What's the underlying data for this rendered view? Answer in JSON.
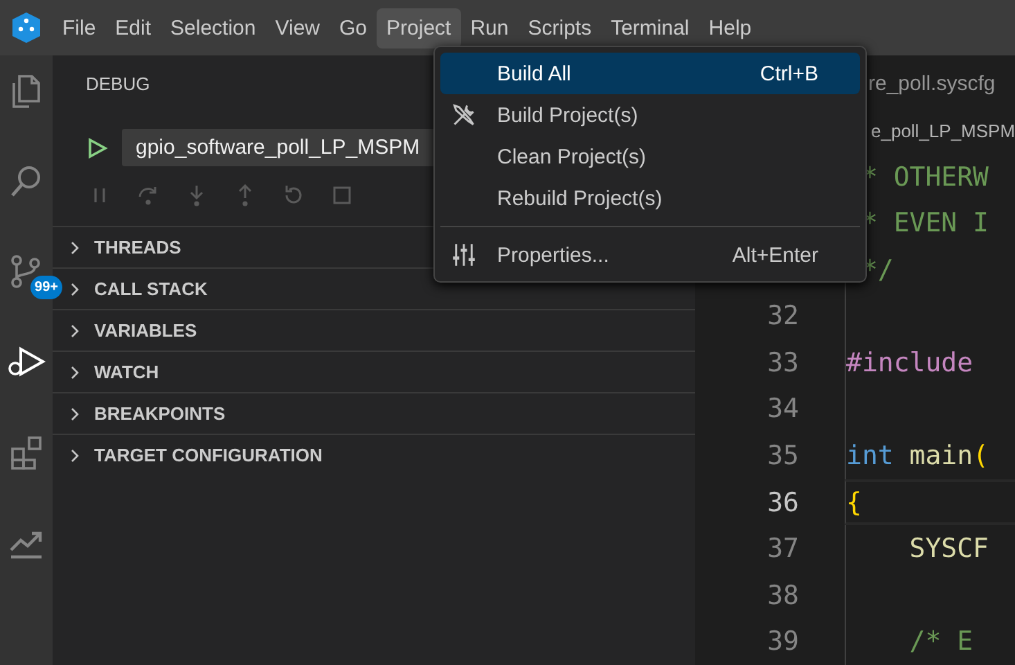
{
  "menubar": {
    "items": [
      {
        "label": "File",
        "selected": false
      },
      {
        "label": "Edit",
        "selected": false
      },
      {
        "label": "Selection",
        "selected": false
      },
      {
        "label": "View",
        "selected": false
      },
      {
        "label": "Go",
        "selected": false
      },
      {
        "label": "Project",
        "selected": true
      },
      {
        "label": "Run",
        "selected": false
      },
      {
        "label": "Scripts",
        "selected": false
      },
      {
        "label": "Terminal",
        "selected": false
      },
      {
        "label": "Help",
        "selected": false
      }
    ]
  },
  "activity_bar": {
    "items": [
      {
        "kind": "files",
        "selected": false
      },
      {
        "kind": "search",
        "selected": false
      },
      {
        "kind": "source-control",
        "selected": false,
        "badge": "99+"
      },
      {
        "kind": "debug",
        "selected": true
      },
      {
        "kind": "extensions",
        "selected": false
      },
      {
        "kind": "chart",
        "selected": false
      }
    ]
  },
  "sidebar": {
    "title": "DEBUG",
    "launch_config": "gpio_software_poll_LP_MSPM",
    "toolbar": [
      {
        "kind": "pause",
        "disabled": true
      },
      {
        "kind": "step-over",
        "disabled": true
      },
      {
        "kind": "step-into",
        "disabled": true
      },
      {
        "kind": "step-out",
        "disabled": true
      },
      {
        "kind": "restart",
        "disabled": true
      },
      {
        "kind": "stop",
        "disabled": true
      }
    ],
    "sections": [
      {
        "label": "THREADS",
        "expanded": false
      },
      {
        "label": "CALL STACK",
        "expanded": false
      },
      {
        "label": "VARIABLES",
        "expanded": false
      },
      {
        "label": "WATCH",
        "expanded": false
      },
      {
        "label": "BREAKPOINTS",
        "expanded": false
      },
      {
        "label": "TARGET CONFIGURATION",
        "expanded": false
      }
    ]
  },
  "editor": {
    "tab": "re_poll.syscfg",
    "breadcrumb": "e_poll_LP_MSPM",
    "lines": [
      {
        "segments": [
          {
            "text": " * OTHERW",
            "kind": "comment"
          }
        ]
      },
      {
        "segments": [
          {
            "text": " * EVEN I",
            "kind": "comment"
          }
        ]
      },
      {
        "segments": [
          {
            "text": " */",
            "kind": "comment"
          }
        ]
      },
      {
        "number": "32",
        "current": false
      },
      {
        "number": "33",
        "current": false,
        "segments": [
          {
            "text": "#include",
            "kind": "directive"
          }
        ]
      },
      {
        "number": "34",
        "current": false
      },
      {
        "number": "35",
        "current": false,
        "segments": [
          {
            "text": "int",
            "kind": "keyword"
          },
          {
            "text": " main",
            "kind": "function"
          },
          {
            "text": "(",
            "kind": "bracket"
          }
        ]
      },
      {
        "number": "36",
        "current": true,
        "segments": [
          {
            "text": "{",
            "kind": "bracket"
          }
        ]
      },
      {
        "number": "37",
        "current": false,
        "segments": [
          {
            "text": "    SYSCF",
            "kind": "function"
          }
        ]
      },
      {
        "number": "38",
        "current": false
      },
      {
        "number": "39",
        "current": false,
        "segments": [
          {
            "text": "    /* E",
            "kind": "comment"
          }
        ]
      }
    ]
  },
  "menu": {
    "items": [
      {
        "kind": "item",
        "label": "Build All",
        "shortcut": "Ctrl+B",
        "selected": true
      },
      {
        "kind": "item",
        "label": "Build Project(s)",
        "selected": false
      },
      {
        "kind": "item",
        "label": "Clean Project(s)",
        "selected": false
      },
      {
        "kind": "item",
        "label": "Rebuild Project(s)",
        "selected": false
      },
      {
        "kind": "separator"
      },
      {
        "kind": "item",
        "label": "Properties...",
        "shortcut": "Alt+Enter",
        "selected": false
      }
    ]
  }
}
